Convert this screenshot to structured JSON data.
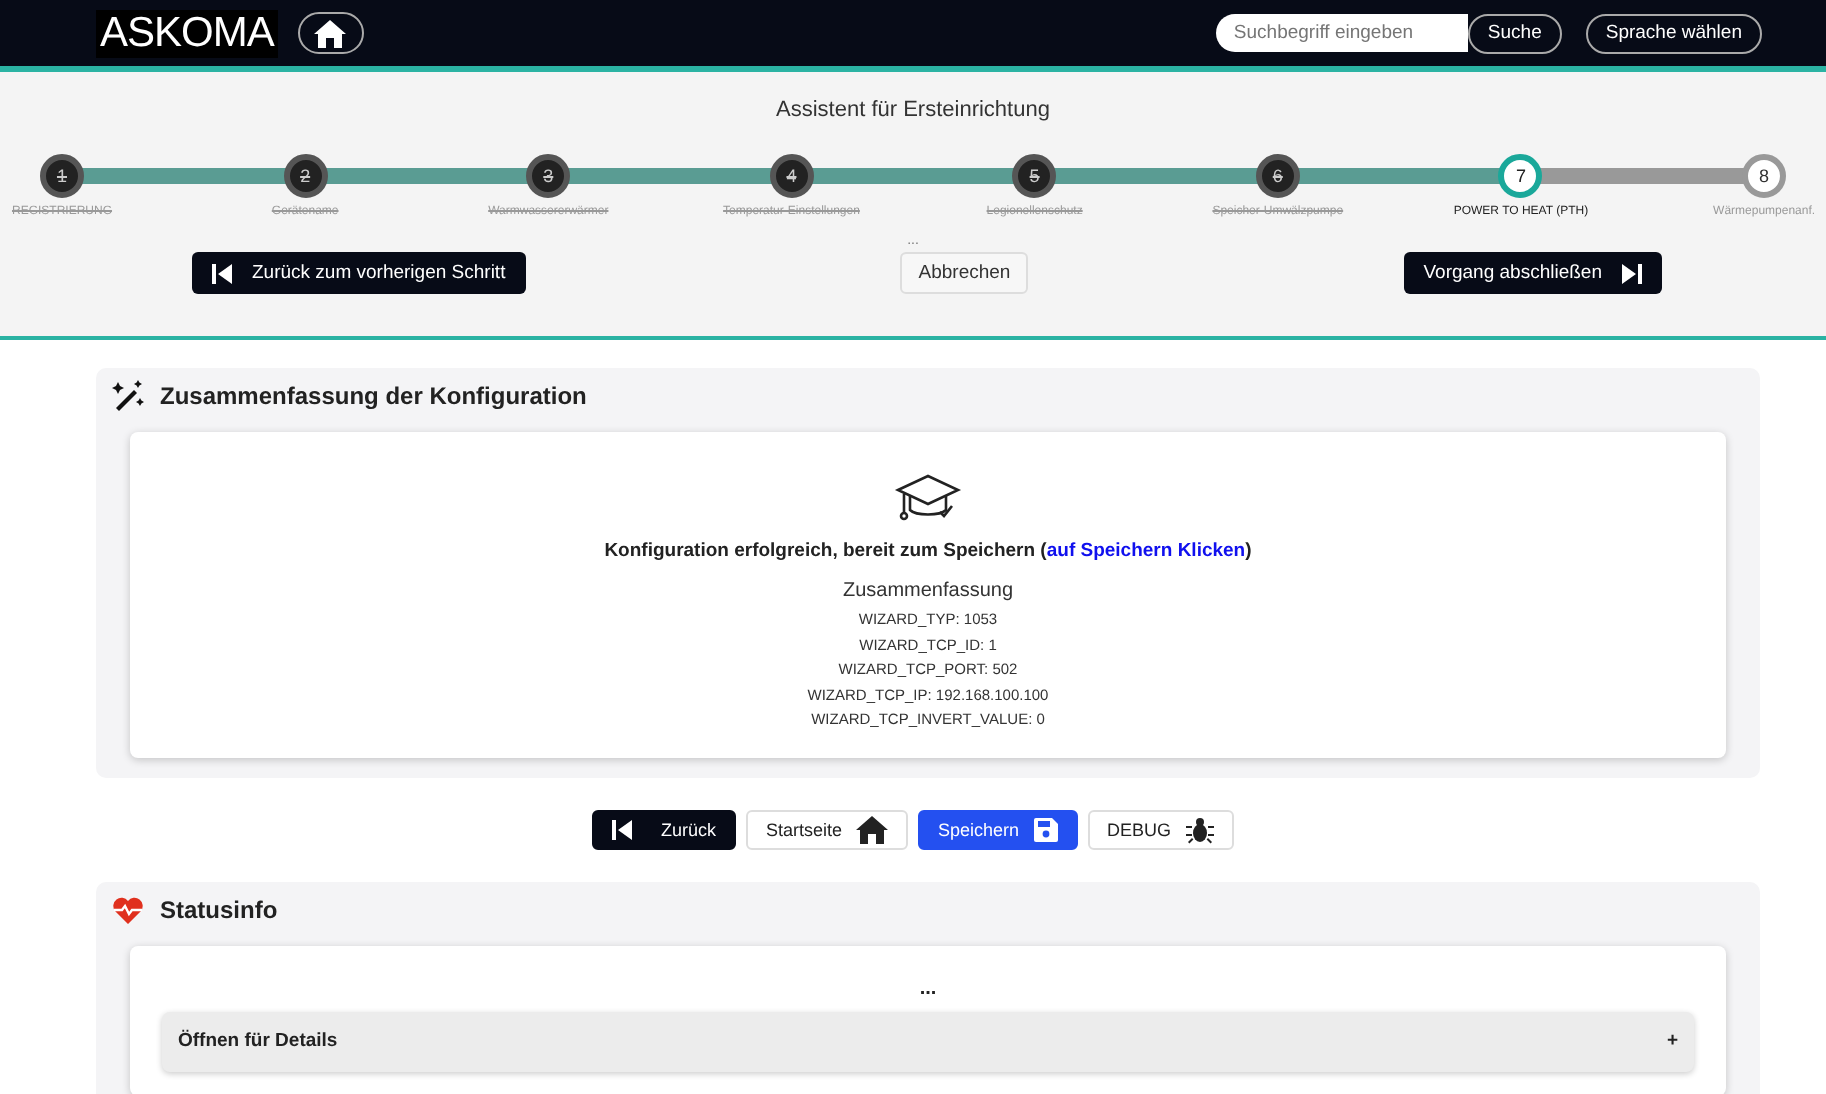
{
  "header": {
    "logo": "ASKOMA",
    "search": {
      "placeholder": "Suchbegriff eingeben",
      "button": "Suche"
    },
    "language_button": "Sprache wählen"
  },
  "wizard": {
    "title": "Assistent für Ersteinrichtung",
    "steps": [
      {
        "number": "1",
        "label": "REGISTRIERUNG",
        "done": true,
        "selected": false
      },
      {
        "number": "2",
        "label": "Gerätename",
        "done": true,
        "selected": false
      },
      {
        "number": "3",
        "label": "Warmwassererwärmer",
        "done": true,
        "selected": false
      },
      {
        "number": "4",
        "label": "Temperatur-Einstellungen",
        "done": true,
        "selected": false
      },
      {
        "number": "5",
        "label": "Legionellenschutz",
        "done": true,
        "selected": false
      },
      {
        "number": "6",
        "label": "Speicher-Umwälzpumpe",
        "done": true,
        "selected": false
      },
      {
        "number": "7",
        "label": "POWER TO HEAT (PTH)",
        "done": false,
        "selected": true
      },
      {
        "number": "8",
        "label": "Wärmepumpenanf.",
        "done": false,
        "selected": false
      }
    ],
    "note": "...",
    "back_button": "Zurück zum vorherigen Schritt",
    "cancel_button": "Abbrechen",
    "finish_button": "Vorgang abschließen"
  },
  "summary": {
    "title": "Zusammenfassung der Konfiguration",
    "message": "Konfiguration erfolgreich, bereit zum Speichern (",
    "link": "auf Speichern Klicken",
    "message_end": ")",
    "subtitle": "Zusammenfassung",
    "items": [
      "WIZARD_TYP: 1053",
      "WIZARD_TCP_ID: 1",
      "WIZARD_TCP_PORT: 502",
      "WIZARD_TCP_IP: 192.168.100.100",
      "WIZARD_TCP_INVERT_VALUE: 0"
    ]
  },
  "actions": [
    {
      "kind": "back",
      "label": "Zurück"
    },
    {
      "kind": "home",
      "label": "Startseite"
    },
    {
      "kind": "save",
      "label": "Speichern"
    },
    {
      "kind": "debug",
      "label": "DEBUG"
    }
  ],
  "status": {
    "title": "Statusinfo",
    "loading": "...",
    "accordion": {
      "label": "Öffnen für Details",
      "toggle": "+",
      "expanded": false
    }
  }
}
